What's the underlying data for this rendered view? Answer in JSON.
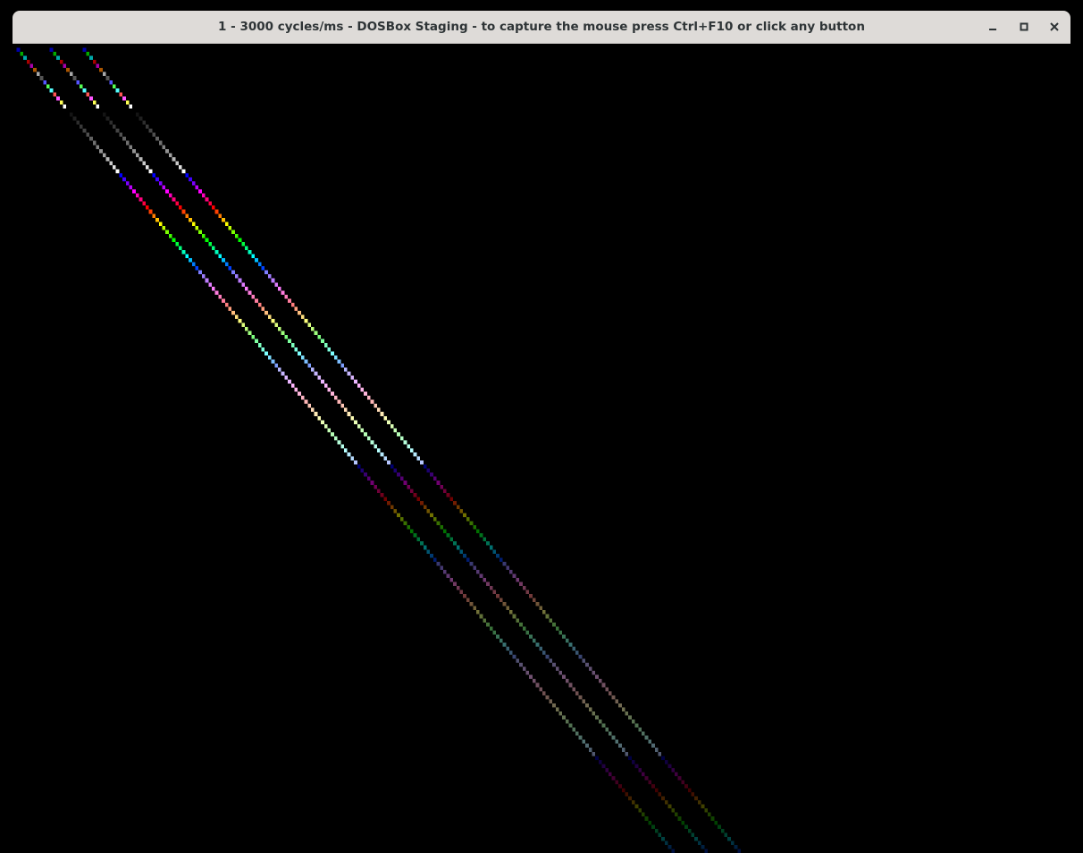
{
  "window": {
    "title": "1 - 3000 cycles/ms - DOSBox Staging - to capture the mouse press Ctrl+F10 or click any button",
    "controls": [
      "minimize",
      "maximize",
      "close"
    ]
  },
  "screen": {
    "mode": "VGA 320x200 256-color",
    "background": "#000000",
    "content": "three diagonal lines drawn with the default VGA palette"
  }
}
